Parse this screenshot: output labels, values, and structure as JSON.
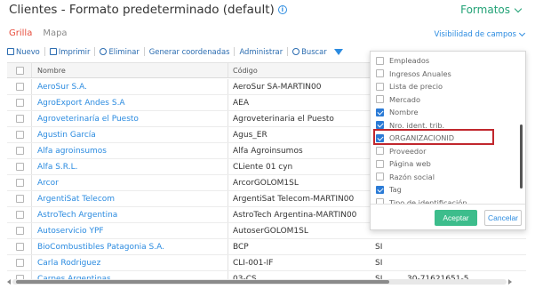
{
  "header": {
    "title": "Clientes - Formato predeterminado (default)",
    "formats_label": "Formatos"
  },
  "tabs": [
    {
      "label": "Grilla",
      "active": true
    },
    {
      "label": "Mapa",
      "active": false
    }
  ],
  "visibility_label": "Visibilidad de campos",
  "toolbar": {
    "new": "Nuevo",
    "print": "Imprimir",
    "delete": "Eliminar",
    "coords": "Generar coordenadas",
    "admin": "Administrar",
    "search": "Buscar"
  },
  "grid": {
    "columns": [
      "Nombre",
      "Código"
    ],
    "rows": [
      {
        "name": "AeroSur S.A.",
        "code": "AeroSur SA-MARTIN00",
        "x": "",
        "y": ""
      },
      {
        "name": "AgroExport Andes S.A",
        "code": "AEA",
        "x": "",
        "y": ""
      },
      {
        "name": "Agroveterinaría el Puesto",
        "code": "Agroveterinaria el Puesto",
        "x": "",
        "y": ""
      },
      {
        "name": "Agustin García",
        "code": "Agus_ER",
        "x": "",
        "y": ""
      },
      {
        "name": "Alfa agroinsumos",
        "code": "Alfa Agroinsumos",
        "x": "",
        "y": ""
      },
      {
        "name": "Alfa S.R.L.",
        "code": "CLiente 01 cyn",
        "x": "",
        "y": ""
      },
      {
        "name": "Arcor",
        "code": "ArcorGOLOM1SL",
        "x": "",
        "y": ""
      },
      {
        "name": "ArgentiSat Telecom",
        "code": "ArgentiSat Telecom-MARTIN00",
        "x": "",
        "y": ""
      },
      {
        "name": "AstroTech Argentina",
        "code": "AstroTech Argentina-MARTIN00",
        "x": "",
        "y": ""
      },
      {
        "name": "Autoservicio YPF",
        "code": "AutoserGOLOM1SL",
        "x": "",
        "y": ""
      },
      {
        "name": "BioCombustibles Patagonia S.A.",
        "code": "BCP",
        "x": "SI",
        "y": ""
      },
      {
        "name": "Carla Rodriguez",
        "code": "CLI-001-IF",
        "x": "SI",
        "y": ""
      },
      {
        "name": "Carnes Argentinas",
        "code": "03-CS",
        "x": "SI",
        "y": "30-71621651-5"
      }
    ]
  },
  "dropdown": {
    "items": [
      {
        "label": "Empleados",
        "checked": false
      },
      {
        "label": "Ingresos Anuales",
        "checked": false
      },
      {
        "label": "Lista de precio",
        "checked": false
      },
      {
        "label": "Mercado",
        "checked": false
      },
      {
        "label": "Nombre",
        "checked": true
      },
      {
        "label": "Nro. ident. trib.",
        "checked": true
      },
      {
        "label": "ORGANIZACIONID",
        "checked": true
      },
      {
        "label": "Proveedor",
        "checked": false
      },
      {
        "label": "Página web",
        "checked": false
      },
      {
        "label": "Razón social",
        "checked": false
      },
      {
        "label": "Tag",
        "checked": true
      },
      {
        "label": "Tipo de identificación",
        "checked": false
      }
    ],
    "accept": "Aceptar",
    "cancel": "Cancelar"
  },
  "colors": {
    "accent_green": "#3dbd8c",
    "link_blue": "#2b8be0",
    "active_tab_red": "#e74c3c",
    "highlight_red": "#c1272d"
  }
}
